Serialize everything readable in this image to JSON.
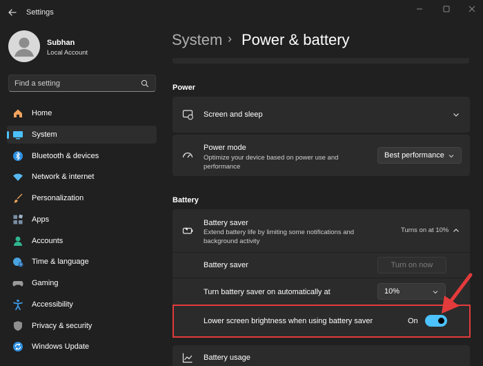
{
  "window": {
    "title": "Settings",
    "back_icon": "back-arrow-icon",
    "controls": [
      "minimize-icon",
      "maximize-icon",
      "close-icon"
    ]
  },
  "profile": {
    "name": "Subhan",
    "account_type": "Local Account"
  },
  "search": {
    "placeholder": "Find a setting",
    "value": ""
  },
  "sidebar": {
    "items": [
      {
        "label": "Home",
        "icon": "home-icon",
        "color": "#f0a35c"
      },
      {
        "label": "System",
        "icon": "system-icon",
        "color": "#4cc2ff",
        "active": true
      },
      {
        "label": "Bluetooth & devices",
        "icon": "bluetooth-icon",
        "color": "#2f8fe0"
      },
      {
        "label": "Network & internet",
        "icon": "wifi-icon",
        "color": "#58b7f0"
      },
      {
        "label": "Personalization",
        "icon": "brush-icon",
        "color": "#e3a15a"
      },
      {
        "label": "Apps",
        "icon": "apps-icon",
        "color": "#7a8fa6"
      },
      {
        "label": "Accounts",
        "icon": "person-icon",
        "color": "#2fb58f"
      },
      {
        "label": "Time & language",
        "icon": "globe-clock-icon",
        "color": "#4aa3e0"
      },
      {
        "label": "Gaming",
        "icon": "gamepad-icon",
        "color": "#9a9a9a"
      },
      {
        "label": "Accessibility",
        "icon": "accessibility-icon",
        "color": "#3d9be9"
      },
      {
        "label": "Privacy & security",
        "icon": "shield-icon",
        "color": "#8f8f8f"
      },
      {
        "label": "Windows Update",
        "icon": "update-icon",
        "color": "#2f8fe0"
      }
    ]
  },
  "breadcrumb": {
    "parent": "System",
    "separator": "›",
    "current": "Power & battery"
  },
  "sections": {
    "power": "Power",
    "battery": "Battery"
  },
  "power": {
    "screen_sleep": {
      "title": "Screen and sleep",
      "icon": "screen-sleep-icon"
    },
    "power_mode": {
      "title": "Power mode",
      "description": "Optimize your device based on power use and performance",
      "value": "Best performance",
      "icon": "power-mode-icon"
    }
  },
  "battery": {
    "saver_header": {
      "title": "Battery saver",
      "description": "Extend battery life by limiting some notifications and background activity",
      "status": "Turns on at 10%",
      "icon": "battery-saver-icon"
    },
    "saver_row": {
      "label": "Battery saver",
      "button": "Turn on now"
    },
    "auto_row": {
      "label": "Turn battery saver on automatically at",
      "value": "10%"
    },
    "brightness_row": {
      "label": "Lower screen brightness when using battery saver",
      "state": "On",
      "toggle_on": true
    },
    "usage": {
      "title": "Battery usage",
      "icon": "battery-usage-icon"
    }
  },
  "colors": {
    "accent": "#4cc2ff",
    "annotation": "#e33b3b"
  }
}
